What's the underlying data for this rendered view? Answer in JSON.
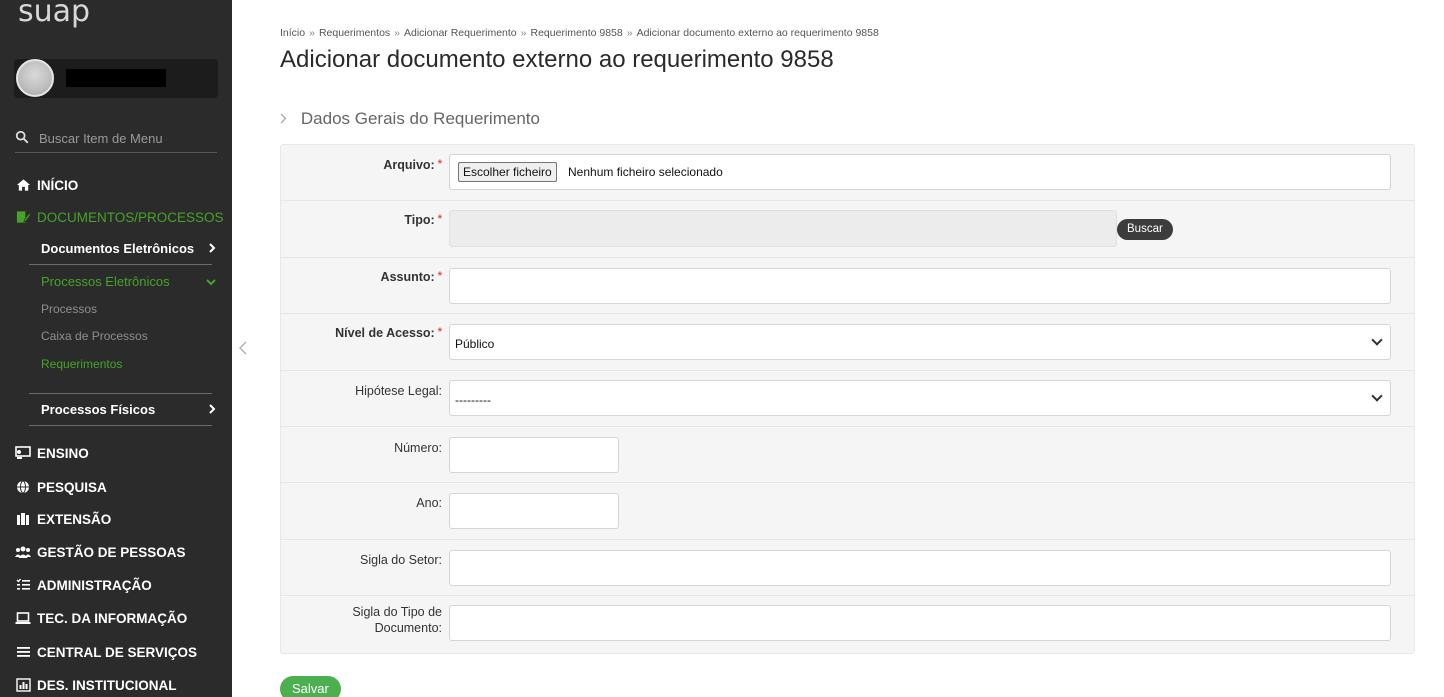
{
  "sidebar": {
    "logo": "suap",
    "search_placeholder": "Buscar Item de Menu",
    "inicio": "INÍCIO",
    "documentos": "DOCUMENTOS/PROCESSOS",
    "documentos_eletronicos": "Documentos Eletrônicos",
    "processos_eletronicos": "Processos Eletrônicos",
    "processos": "Processos",
    "caixa_processos": "Caixa de Processos",
    "requerimentos": "Requerimentos",
    "processos_fisicos": "Processos Físicos",
    "ensino": "ENSINO",
    "pesquisa": "PESQUISA",
    "extensao": "EXTENSÃO",
    "gestao_pessoas": "GESTÃO DE PESSOAS",
    "administracao": "ADMINISTRAÇÃO",
    "tec_informacao": "TEC. DA INFORMAÇÃO",
    "central_servicos": "CENTRAL DE SERVIÇOS",
    "des_institucional": "DES. INSTITUCIONAL"
  },
  "breadcrumb": {
    "items": [
      "Início",
      "Requerimentos",
      "Adicionar Requerimento",
      "Requerimento 9858",
      "Adicionar documento externo ao requerimento 9858"
    ],
    "separator": "»"
  },
  "page_title": "Adicionar documento externo ao requerimento 9858",
  "section_title": "Dados Gerais do Requerimento",
  "form": {
    "arquivo_label": "Arquivo:",
    "arquivo_button": "Escolher ficheiro",
    "arquivo_status": "Nenhum ficheiro selecionado",
    "tipo_label": "Tipo:",
    "buscar_button": "Buscar",
    "assunto_label": "Assunto:",
    "nivel_label": "Nível de Acesso:",
    "nivel_value": "Público",
    "hipotese_label": "Hipótese Legal:",
    "hipotese_value": "---------",
    "numero_label": "Número:",
    "ano_label": "Ano:",
    "sigla_setor_label": "Sigla do Setor:",
    "sigla_tipo_label_1": "Sigla do Tipo de",
    "sigla_tipo_label_2": "Documento:",
    "required_mark": "*"
  },
  "save_button": "Salvar",
  "colors": {
    "accent_green": "#46a32a",
    "sidebar_bg": "#2b2b2b",
    "required_red": "#d9534f"
  }
}
